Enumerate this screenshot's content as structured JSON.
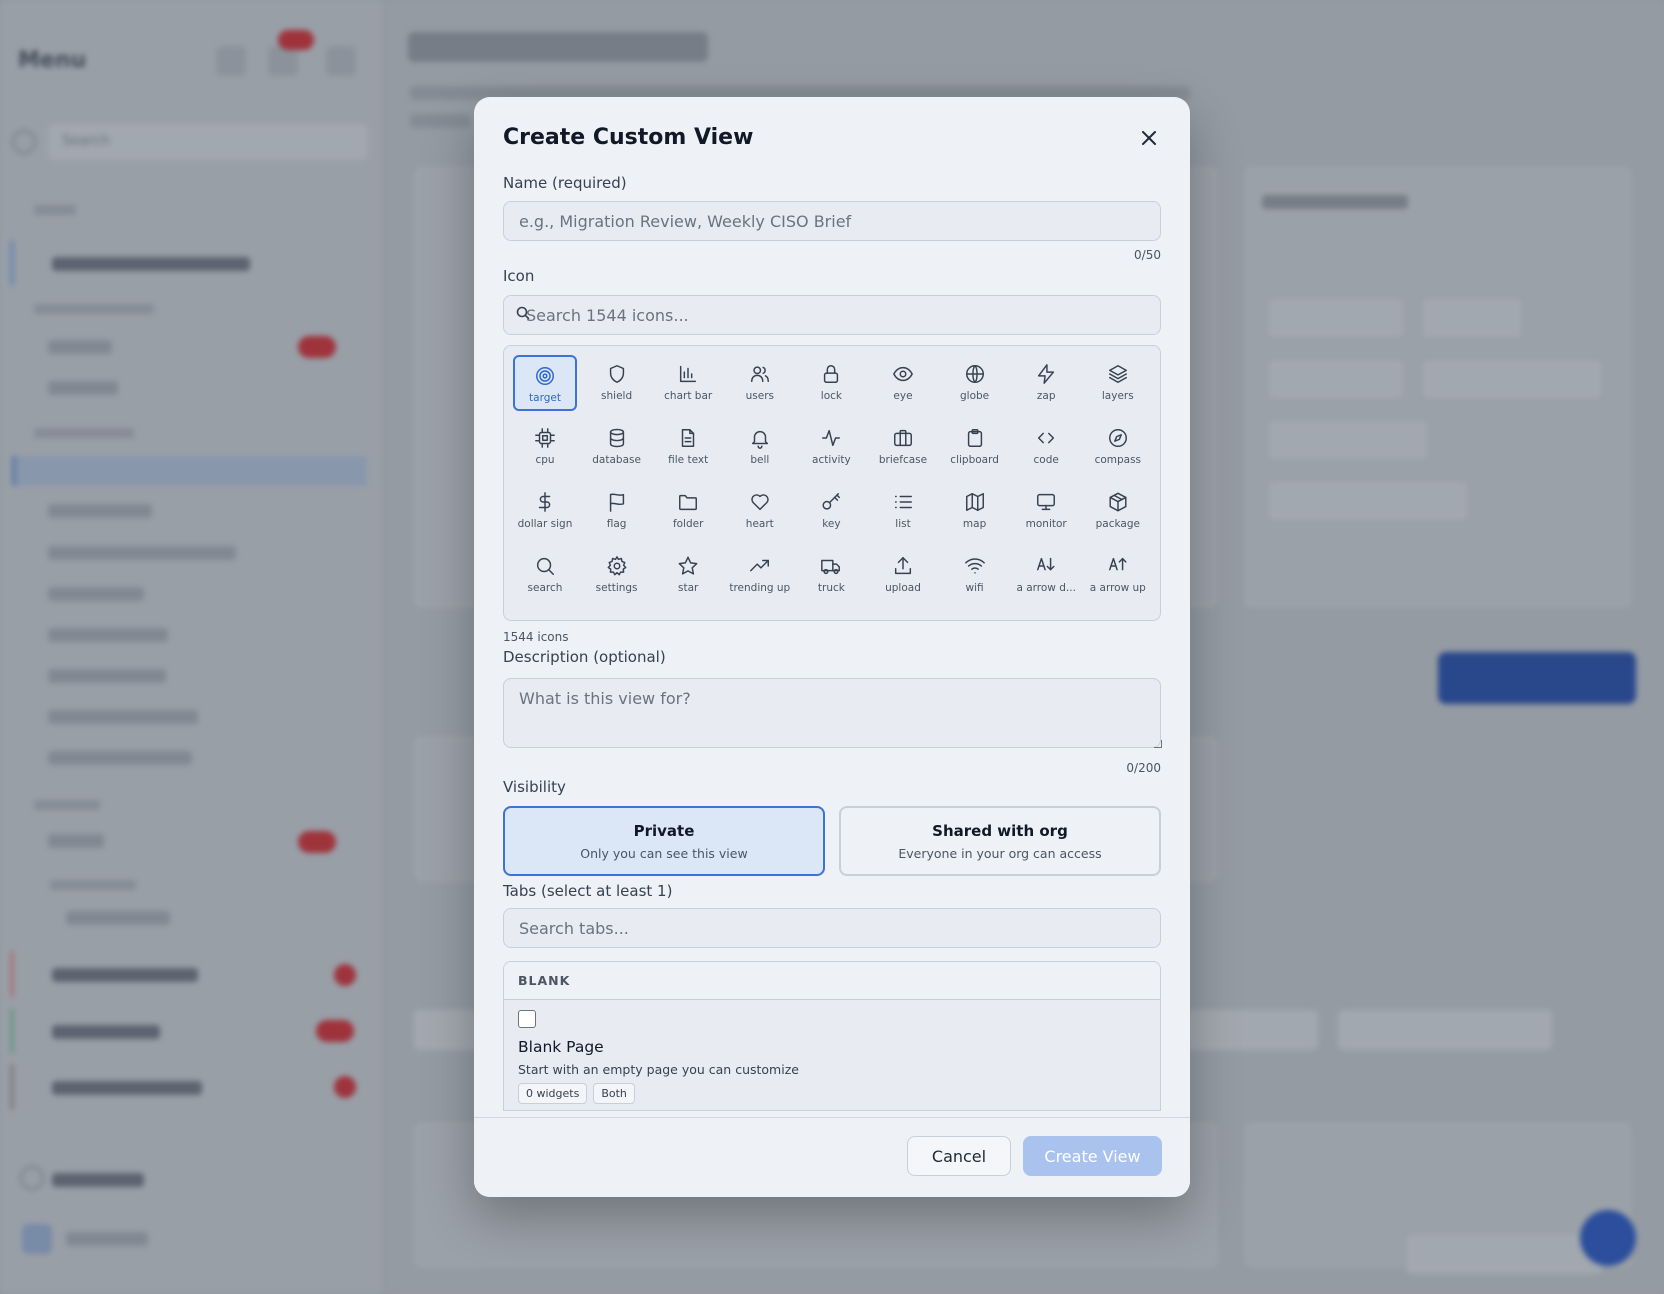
{
  "background": {
    "menu_title": "Menu",
    "search_placeholder": "Search"
  },
  "modal": {
    "title": "Create Custom View",
    "name": {
      "label": "Name (required)",
      "placeholder": "e.g., Migration Review, Weekly CISO Brief",
      "counter": "0/50"
    },
    "icon": {
      "label": "Icon",
      "search_placeholder": "Search 1544 icons...",
      "count_text": "1544 icons",
      "selected": "target",
      "items": [
        {
          "id": "target",
          "label": "target"
        },
        {
          "id": "shield",
          "label": "shield"
        },
        {
          "id": "chart-bar",
          "label": "chart bar"
        },
        {
          "id": "users",
          "label": "users"
        },
        {
          "id": "lock",
          "label": "lock"
        },
        {
          "id": "eye",
          "label": "eye"
        },
        {
          "id": "globe",
          "label": "globe"
        },
        {
          "id": "zap",
          "label": "zap"
        },
        {
          "id": "layers",
          "label": "layers"
        },
        {
          "id": "cpu",
          "label": "cpu"
        },
        {
          "id": "database",
          "label": "database"
        },
        {
          "id": "file-text",
          "label": "file text"
        },
        {
          "id": "bell",
          "label": "bell"
        },
        {
          "id": "activity",
          "label": "activity"
        },
        {
          "id": "briefcase",
          "label": "briefcase"
        },
        {
          "id": "clipboard",
          "label": "clipboard"
        },
        {
          "id": "code",
          "label": "code"
        },
        {
          "id": "compass",
          "label": "compass"
        },
        {
          "id": "dollar-sign",
          "label": "dollar sign"
        },
        {
          "id": "flag",
          "label": "flag"
        },
        {
          "id": "folder",
          "label": "folder"
        },
        {
          "id": "heart",
          "label": "heart"
        },
        {
          "id": "key",
          "label": "key"
        },
        {
          "id": "list",
          "label": "list"
        },
        {
          "id": "map",
          "label": "map"
        },
        {
          "id": "monitor",
          "label": "monitor"
        },
        {
          "id": "package",
          "label": "package"
        },
        {
          "id": "search",
          "label": "search"
        },
        {
          "id": "settings",
          "label": "settings"
        },
        {
          "id": "star",
          "label": "star"
        },
        {
          "id": "trending-up",
          "label": "trending up"
        },
        {
          "id": "truck",
          "label": "truck"
        },
        {
          "id": "upload",
          "label": "upload"
        },
        {
          "id": "wifi",
          "label": "wifi"
        },
        {
          "id": "a-arrow-down",
          "label": "a arrow d..."
        },
        {
          "id": "a-arrow-up",
          "label": "a arrow up"
        }
      ]
    },
    "description": {
      "label": "Description (optional)",
      "placeholder": "What is this view for?",
      "counter": "0/200"
    },
    "visibility": {
      "label": "Visibility",
      "selected": "private",
      "options": [
        {
          "id": "private",
          "title": "Private",
          "subtitle": "Only you can see this view"
        },
        {
          "id": "shared",
          "title": "Shared with org",
          "subtitle": "Everyone in your org can access"
        }
      ]
    },
    "tabs": {
      "label": "Tabs (select at least 1)",
      "search_placeholder": "Search tabs...",
      "group": "BLANK",
      "items": [
        {
          "name": "Blank Page",
          "description": "Start with an empty page you can customize",
          "tags": [
            "0 widgets",
            "Both"
          ],
          "checked": false
        }
      ]
    },
    "footer": {
      "cancel_label": "Cancel",
      "create_label": "Create View"
    }
  }
}
